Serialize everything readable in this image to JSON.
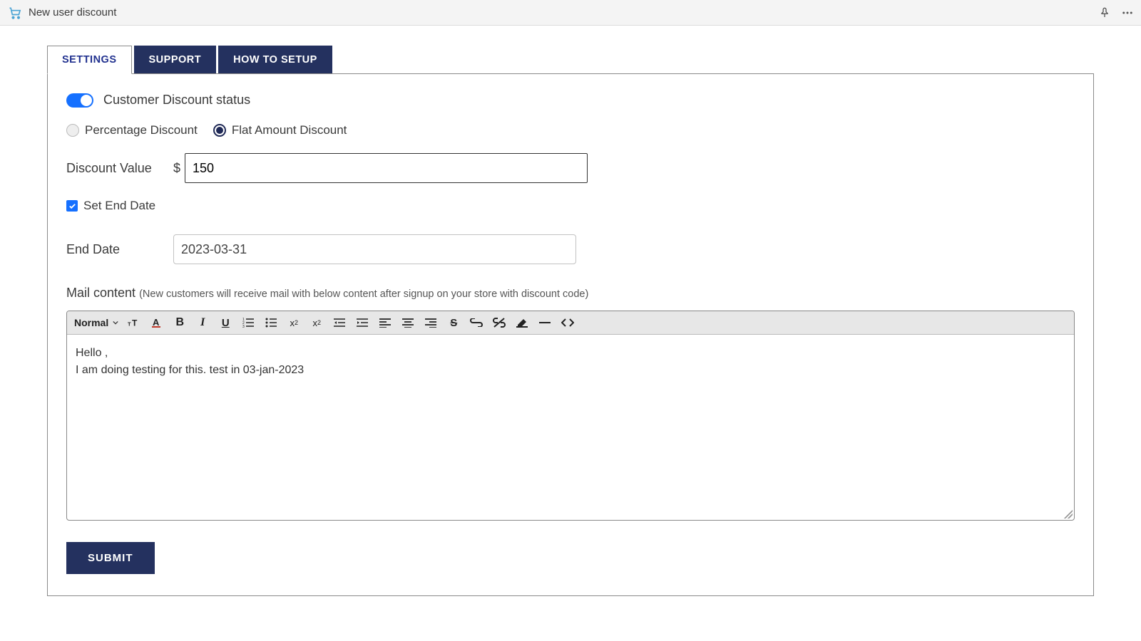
{
  "header": {
    "title": "New user discount"
  },
  "tabs": [
    {
      "label": "Settings",
      "active": true
    },
    {
      "label": "Support",
      "active": false
    },
    {
      "label": "How to Setup",
      "active": false
    }
  ],
  "form": {
    "status_label": "Customer Discount status",
    "status_on": true,
    "discount_type": {
      "options": [
        {
          "label": "Percentage Discount",
          "selected": false
        },
        {
          "label": "Flat Amount Discount",
          "selected": true
        }
      ]
    },
    "discount_value": {
      "label": "Discount Value",
      "currency": "$",
      "value": "150"
    },
    "set_end_date": {
      "label": "Set End Date",
      "checked": true
    },
    "end_date": {
      "label": "End Date",
      "value": "2023-03-31"
    },
    "mail": {
      "label": "Mail content",
      "hint": "(New customers will receive mail with below content after signup on your store with discount code)",
      "toolbar": {
        "style_select": "Normal"
      },
      "body_line1": "Hello ,",
      "body_line2": "I am doing testing for this. test in 03-jan-2023"
    },
    "submit_label": "Submit"
  }
}
